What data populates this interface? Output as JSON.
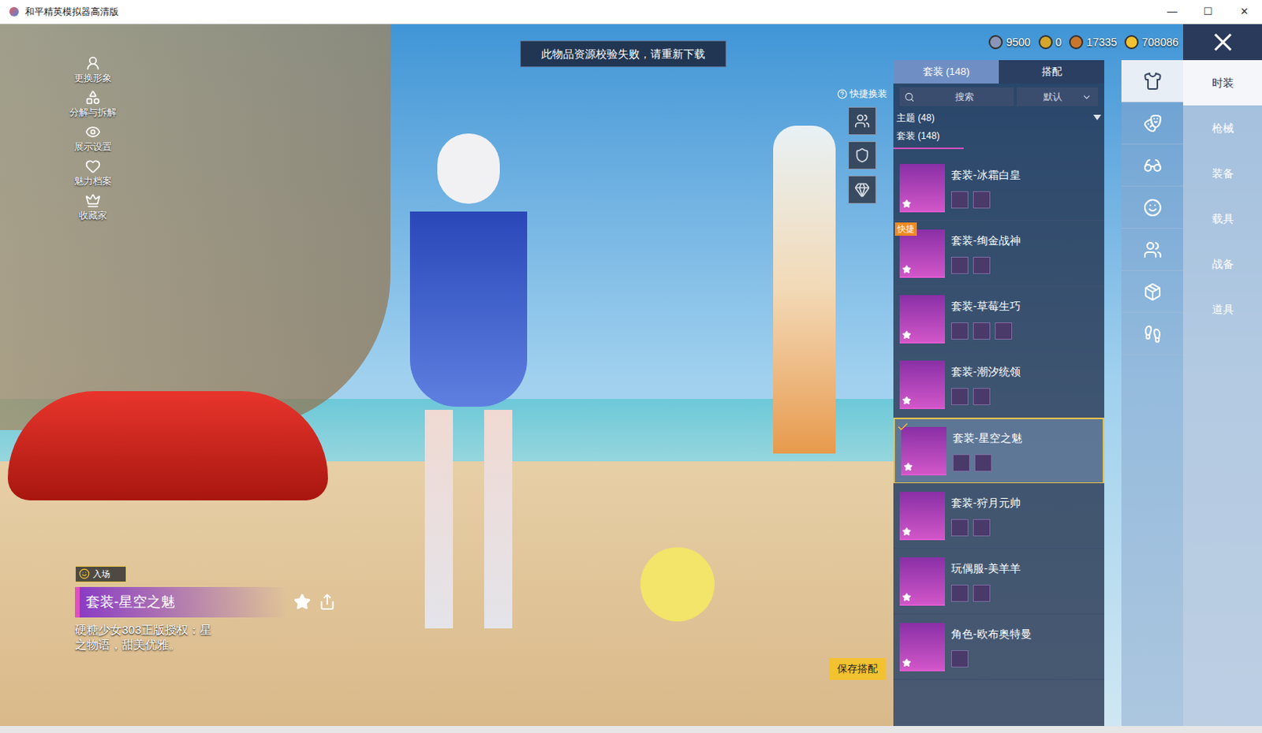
{
  "window": {
    "title": "和平精英模拟器高清版",
    "controls": [
      "—",
      "☐",
      "✕"
    ]
  },
  "toast": "此物品资源校验失败，请重新下载",
  "left_menu": [
    {
      "label": "更换形象"
    },
    {
      "label": "分解与拆解"
    },
    {
      "label": "展示设置"
    },
    {
      "label": "魅力档案"
    },
    {
      "label": "收藏家"
    }
  ],
  "currencies": [
    {
      "value": "9500",
      "color": "#8a96b8"
    },
    {
      "value": "0",
      "color": "#d4a72c"
    },
    {
      "value": "17335",
      "color": "#c9772e"
    },
    {
      "value": "708086",
      "color": "#f2c230"
    }
  ],
  "quick_swap": {
    "label": "快捷换装"
  },
  "panel": {
    "tabs": [
      {
        "label": "套装 (148)",
        "selected": true
      },
      {
        "label": "搭配",
        "selected": false
      }
    ],
    "search": {
      "placeholder": "搜索"
    },
    "sort": {
      "value": "默认"
    },
    "filter": "主题 (48)",
    "section": "套装 (148)",
    "items": [
      {
        "name": "套装-冰霜白皇",
        "parts": 2,
        "badge": "",
        "selected": false
      },
      {
        "name": "套装-绚金战神",
        "parts": 2,
        "badge": "快捷",
        "selected": false
      },
      {
        "name": "套装-草莓生巧",
        "parts": 3,
        "badge": "",
        "selected": false
      },
      {
        "name": "套装-潮汐统领",
        "parts": 2,
        "badge": "",
        "selected": false
      },
      {
        "name": "套装-星空之魅",
        "parts": 2,
        "badge": "",
        "selected": true
      },
      {
        "name": "套装-狩月元帅",
        "parts": 2,
        "badge": "",
        "selected": false
      },
      {
        "name": "玩偶服-美羊羊",
        "parts": 2,
        "badge": "",
        "selected": false
      },
      {
        "name": "角色-欧布奥特曼",
        "parts": 1,
        "badge": "",
        "selected": false
      }
    ]
  },
  "icon_tabs": [
    {
      "selected": true
    },
    {
      "selected": false
    },
    {
      "selected": false
    },
    {
      "selected": false
    },
    {
      "selected": false
    },
    {
      "selected": false
    },
    {
      "selected": false
    }
  ],
  "categories": [
    {
      "label": "时装",
      "selected": true
    },
    {
      "label": "枪械",
      "selected": false
    },
    {
      "label": "装备",
      "selected": false
    },
    {
      "label": "载具",
      "selected": false
    },
    {
      "label": "战备",
      "selected": false
    },
    {
      "label": "道具",
      "selected": false
    }
  ],
  "detail": {
    "badge": "入场",
    "title": "套装-星空之魅",
    "description": "硬糖少女303正版授权：星之物语，甜美优雅。"
  },
  "save_button": "保存搭配"
}
